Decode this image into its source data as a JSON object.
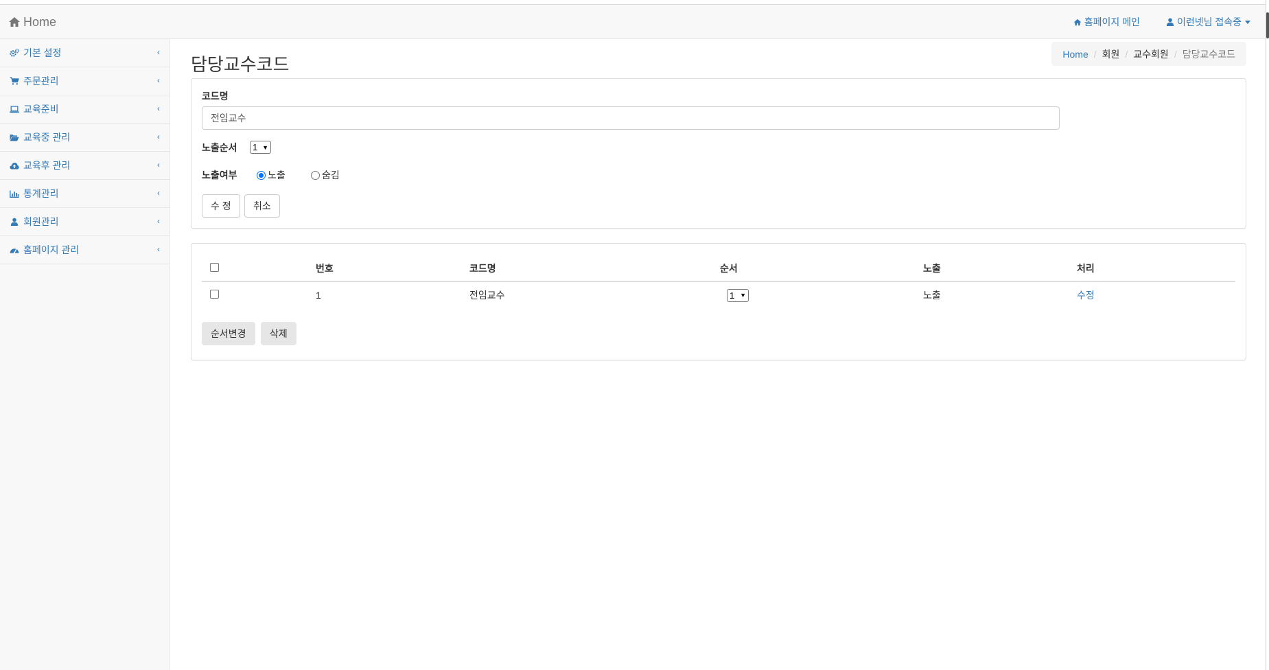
{
  "navbar": {
    "brand": "Home",
    "homepage_link": "홈페이지 메인",
    "user_link": "이런넷님 접속중"
  },
  "sidebar": {
    "items": [
      {
        "label": "기본 설정",
        "icon": "gears-icon"
      },
      {
        "label": "주문관리",
        "icon": "cart-icon"
      },
      {
        "label": "교육준비",
        "icon": "laptop-icon"
      },
      {
        "label": "교육중 관리",
        "icon": "folder-open-icon"
      },
      {
        "label": "교육후 관리",
        "icon": "cloud-upload-icon"
      },
      {
        "label": "통계관리",
        "icon": "bar-chart-icon"
      },
      {
        "label": "회원관리",
        "icon": "user-icon"
      },
      {
        "label": "홈페이지 관리",
        "icon": "dashboard-icon"
      }
    ]
  },
  "page": {
    "title": "담당교수코드"
  },
  "breadcrumb": {
    "items": [
      "Home",
      "회원",
      "교수회원",
      "담당교수코드"
    ]
  },
  "form": {
    "code_name_label": "코드명",
    "code_name_value": "전임교수",
    "order_label": "노출순서",
    "order_value": "1",
    "visibility_label": "노출여부",
    "visibility_options": [
      "노출",
      "숨김"
    ],
    "visibility_selected": "노출",
    "submit_label": "수 정",
    "cancel_label": "취소"
  },
  "table": {
    "headers": [
      "번호",
      "코드명",
      "순서",
      "노출",
      "처리"
    ],
    "rows": [
      {
        "num": "1",
        "name": "전임교수",
        "order": "1",
        "visible": "노출",
        "action": "수정"
      }
    ],
    "reorder_label": "순서변경",
    "delete_label": "삭제"
  },
  "colors": {
    "link": "#337ab7",
    "navbar_bg": "#f8f8f8",
    "radio_accent": "#0075ff"
  }
}
